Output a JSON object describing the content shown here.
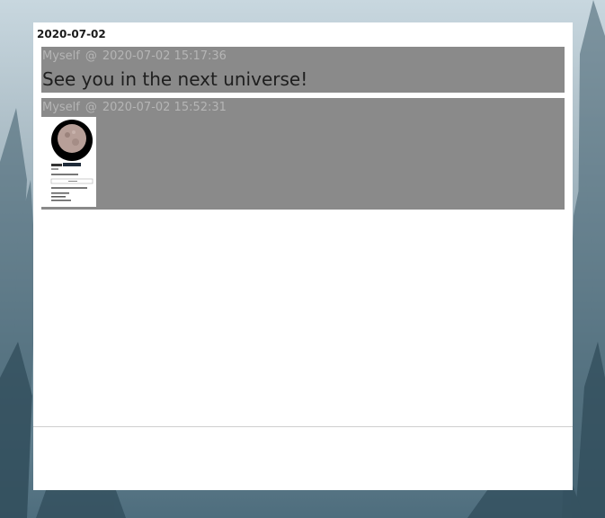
{
  "day": {
    "date": "2020-07-02"
  },
  "messages": [
    {
      "author": "Myself",
      "separator": "@",
      "timestamp": "2020-07-02 15:17:36",
      "text": "See you in the next universe!"
    },
    {
      "author": "Myself",
      "separator": "@",
      "timestamp": "2020-07-02 15:52:31",
      "attachment": "screenshot-thumbnail"
    }
  ],
  "colors": {
    "panel": "#ffffff",
    "message_bg": "#8a8a8a",
    "meta_text": "#b5b5b5",
    "message_text": "#1e1e1e"
  }
}
